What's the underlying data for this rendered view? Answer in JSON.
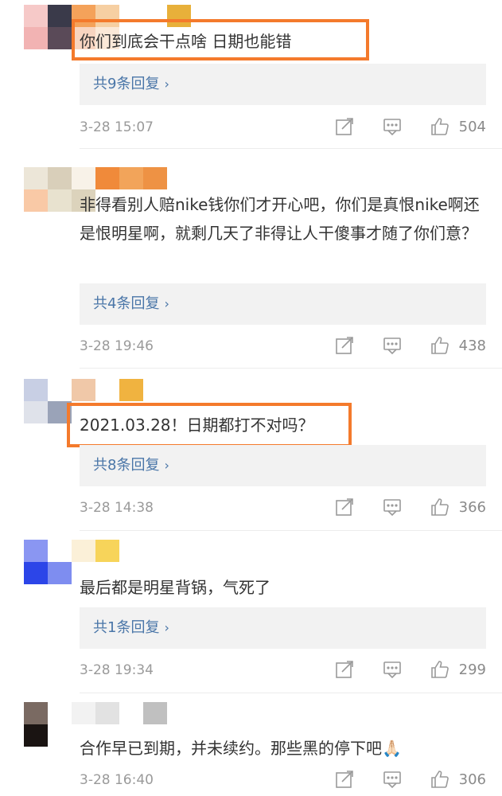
{
  "comments": [
    {
      "text": "你们到底会干点啥 日期也能错",
      "reply_label": "共9条回复",
      "time": "3-28 15:07",
      "likes": "504",
      "mosaic": [
        "#f6c9c8",
        "#3a3a4a",
        "#f4a25a",
        "#f6cfa2",
        "#ffffff",
        "#ffffff",
        "#e8b03a",
        "#f2b3b3",
        "#5a4a58",
        "#f8d5c0",
        "#fbe9d8",
        "#ffffff",
        "#ffffff",
        "#ffffff"
      ]
    },
    {
      "text": "非得看别人赔nike钱你们才开心吧，你们是真恨nike啊还是恨明星啊，就剩几天了非得让人干傻事才随了你们意？",
      "reply_label": "共4条回复",
      "time": "3-28 19:46",
      "likes": "438",
      "mosaic": [
        "#ece6d8",
        "#d9cfba",
        "#f8f2e8",
        "#f08a3a",
        "#f2a45a",
        "#ee9244",
        "#ffffff",
        "#f9c9a6",
        "#e8e2cf",
        "#dcd3bc",
        "#ffffff",
        "#ffffff",
        "#ffffff",
        "#ffffff"
      ]
    },
    {
      "text": "2021.03.28！日期都打不对吗？",
      "reply_label": "共8条回复",
      "time": "3-28 14:38",
      "likes": "366",
      "mosaic": [
        "#c8cfe4",
        "#ffffff",
        "#f0c8a8",
        "#ffffff",
        "#f0b340",
        "#dfe2ea",
        "#9aa3b8",
        "#ffffff",
        "#ffffff",
        "#ffffff"
      ]
    },
    {
      "text": "最后都是明星背锅，气死了",
      "reply_label": "共1条回复",
      "time": "3-28 19:34",
      "likes": "299",
      "mosaic": [
        "#8a96f2",
        "#ffffff",
        "#fbf0d8",
        "#f7d45a",
        "#2c45e8",
        "#7e8df0",
        "#ffffff",
        "#ffffff"
      ]
    },
    {
      "text": "合作早已到期，并未续约。那些黑的停下吧🙏🏻",
      "time": "3-28 16:40",
      "likes": "306",
      "mosaic": [
        "#7a6a62",
        "#ffffff",
        "#f2f2f2",
        "#e2e2e2",
        "#ffffff",
        "#c0c0c0",
        "#1a1412",
        "#ffffff",
        "#ffffff",
        "#ffffff",
        "#ffffff",
        "#ffffff"
      ]
    }
  ],
  "icons": {
    "share": "share-icon",
    "comment": "comment-icon",
    "like": "thumbs-up-icon"
  },
  "colors": {
    "highlight": "#f47a2c",
    "reply_link": "#4a76a8",
    "reply_bg": "#f2f2f2"
  }
}
